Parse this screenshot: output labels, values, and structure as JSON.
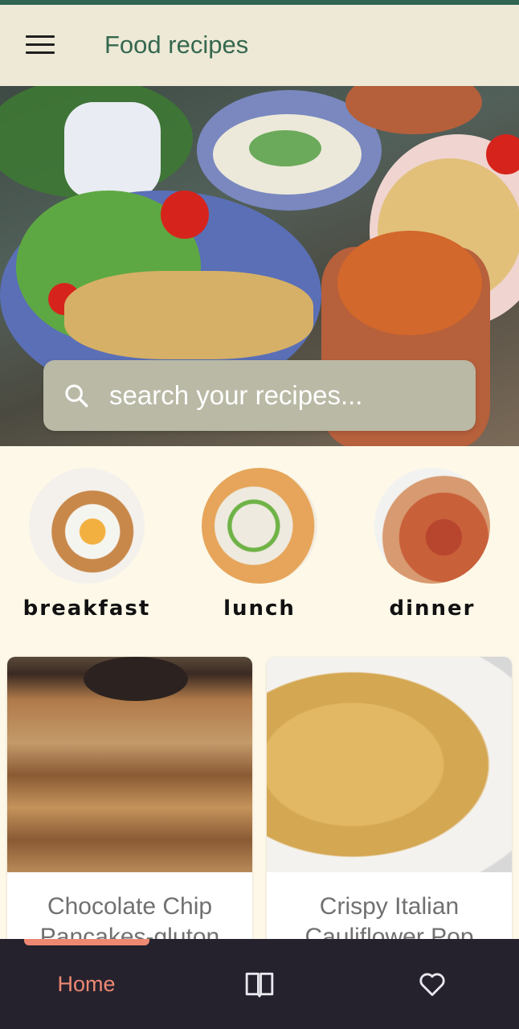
{
  "app_bar": {
    "title": "Food recipes",
    "menu_icon": "hamburger-menu-icon"
  },
  "search": {
    "placeholder": "search your recipes...",
    "value": "",
    "icon": "search-icon"
  },
  "categories": [
    {
      "label": "breakfast"
    },
    {
      "label": "lunch"
    },
    {
      "label": "dinner"
    }
  ],
  "recipes": [
    {
      "title": "Chocolate Chip Pancakes-gluton"
    },
    {
      "title": "Crispy Italian Cauliflower Pop"
    }
  ],
  "bottom_nav": {
    "items": [
      {
        "label": "Home",
        "active": true
      },
      {
        "icon": "book-icon",
        "active": false
      },
      {
        "icon": "heart-icon",
        "active": false
      }
    ]
  },
  "colors": {
    "status_bar": "#2f6552",
    "app_bar_bg": "#ede9d6",
    "title": "#35684f",
    "page_bg": "#fdf8e8",
    "search_bg": "#b9b9a5",
    "nav_bg": "#25222e",
    "accent": "#ee8873"
  }
}
